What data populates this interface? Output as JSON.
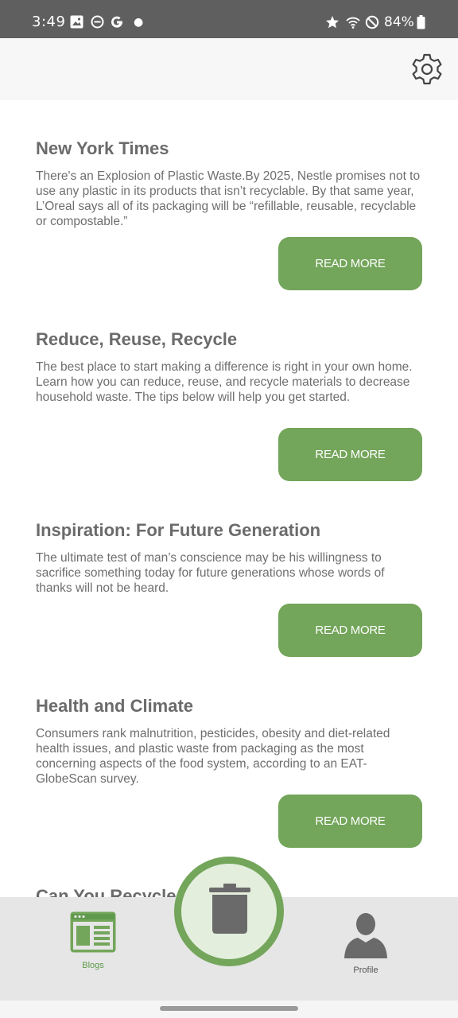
{
  "status_bar": {
    "time": "3:49",
    "battery": "84%"
  },
  "articles": [
    {
      "title": "New York Times",
      "body": "There's an Explosion of Plastic Waste.By 2025, Nestle promises not to use any plastic in its products that isn’t recyclable. By that same year, L’Oreal says all of its packaging will be “refillable, reusable, recyclable or compostable.”",
      "button": "READ MORE"
    },
    {
      "title": "Reduce, Reuse, Recycle",
      "body": "The best place to start making a difference is right in your own home. Learn how you can reduce, reuse, and recycle materials to decrease household waste. The tips below will help you get started.",
      "button": "READ MORE"
    },
    {
      "title": "Inspiration: For Future Generation",
      "body": "The ultimate test of man’s conscience may be his willingness to sacrifice something today for future generations whose words of thanks will not be heard.",
      "button": "READ MORE"
    },
    {
      "title": "Health and Climate",
      "body": "Consumers rank malnutrition, pesticides, obesity and diet-related health issues, and plastic waste from packaging as the most concerning aspects of the food system, according to an EAT-GlobeScan survey.",
      "button": "READ MORE"
    }
  ],
  "partial_article_title": "Can You Recycle Plastics?",
  "bottom_nav": {
    "blogs_label": "Blogs",
    "profile_label": "Profile"
  },
  "icons": {
    "settings": "gear-icon",
    "blogs": "blogs-icon",
    "profile": "profile-icon",
    "center": "trash-can-icon"
  },
  "colors": {
    "accent_green": "#73a55a",
    "fab_fill": "#e3eedd",
    "title_gray": "#6b6b6b",
    "status_bar": "#5f5f5f"
  }
}
